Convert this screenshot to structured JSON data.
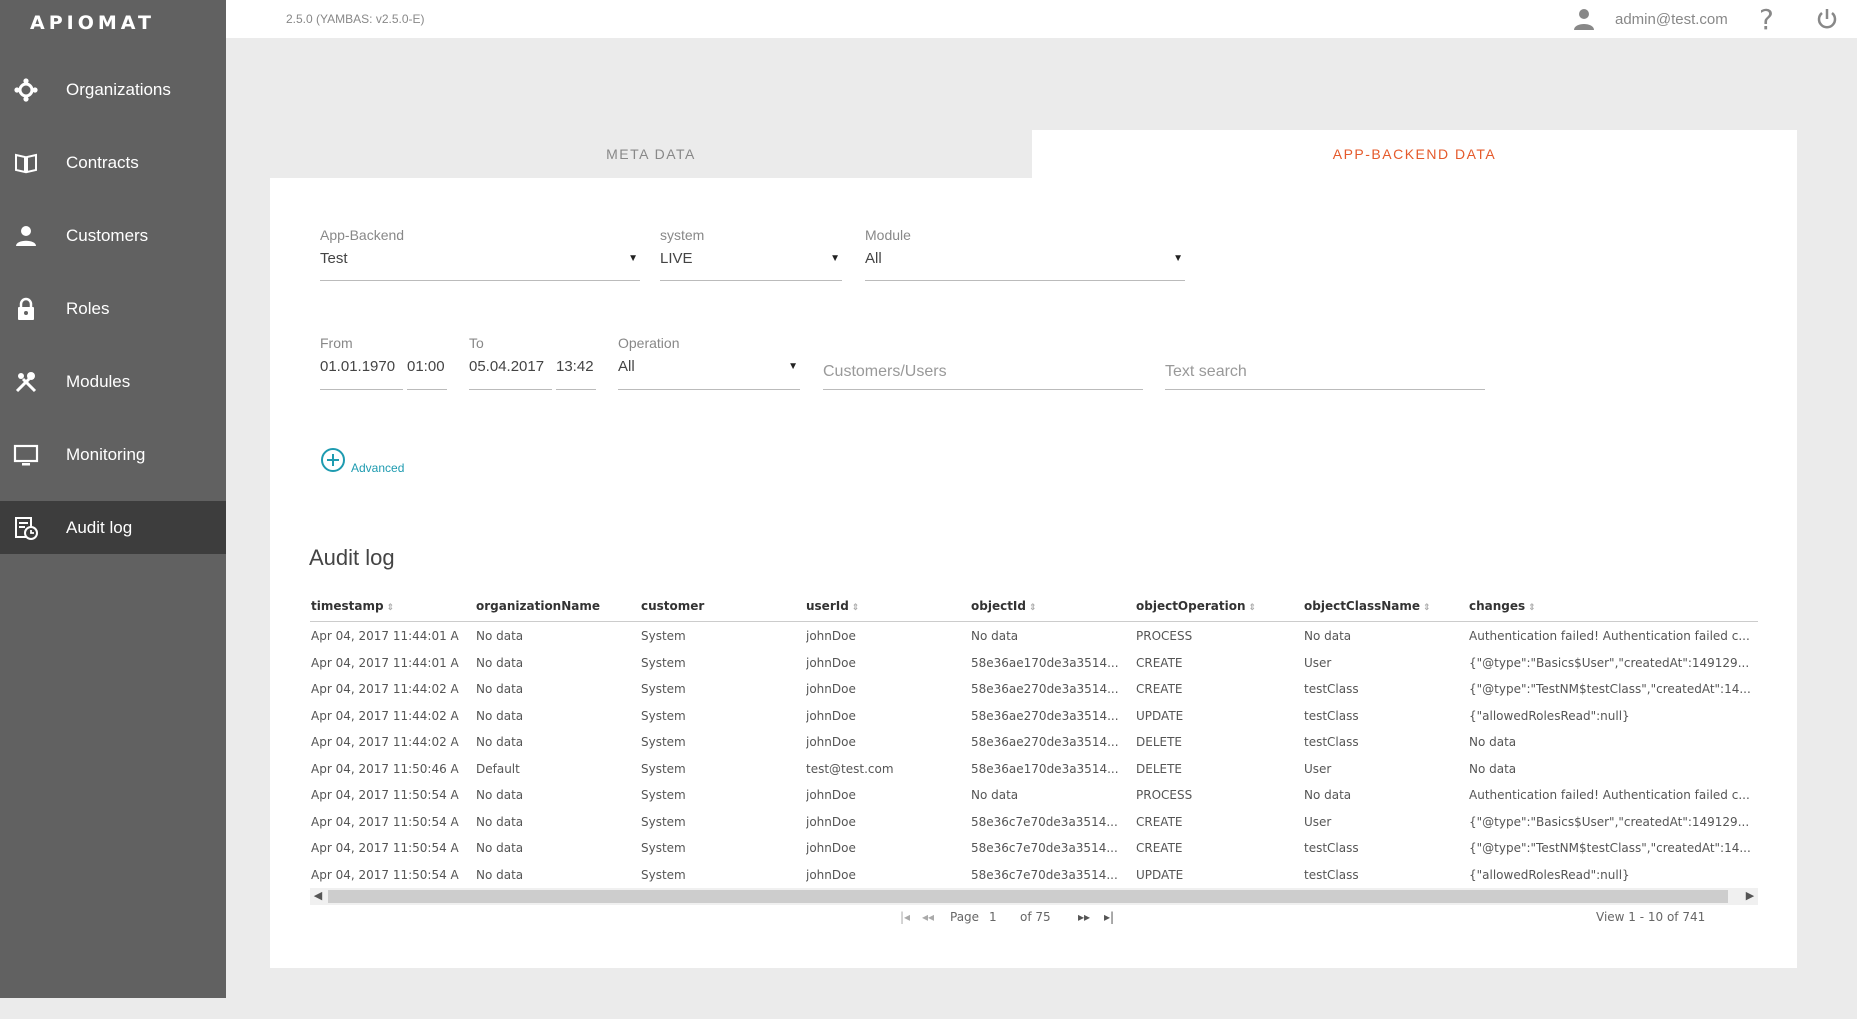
{
  "app": {
    "logo": "APIOMAT",
    "version": "2.5.0 (YAMBAS: v2.5.0-E)"
  },
  "header": {
    "user_email": "admin@test.com",
    "help_symbol": "?"
  },
  "sidebar": {
    "items": [
      {
        "label": "Organizations",
        "icon": "organizations-icon"
      },
      {
        "label": "Contracts",
        "icon": "book-icon"
      },
      {
        "label": "Customers",
        "icon": "person-icon"
      },
      {
        "label": "Roles",
        "icon": "lock-icon"
      },
      {
        "label": "Modules",
        "icon": "tools-icon"
      },
      {
        "label": "Monitoring",
        "icon": "monitor-icon"
      },
      {
        "label": "Audit log",
        "icon": "auditlog-icon",
        "active": true
      }
    ]
  },
  "tabs": [
    {
      "label": "META DATA",
      "active": false
    },
    {
      "label": "APP-BACKEND DATA",
      "active": true
    }
  ],
  "filters": {
    "app_backend": {
      "label": "App-Backend",
      "value": "Test"
    },
    "system": {
      "label": "system",
      "value": "LIVE"
    },
    "module": {
      "label": "Module",
      "value": "All"
    },
    "from": {
      "label": "From",
      "date": "01.01.1970",
      "time": "01:00"
    },
    "to": {
      "label": "To",
      "date": "05.04.2017",
      "time": "13:42"
    },
    "operation": {
      "label": "Operation",
      "value": "All"
    },
    "customers_users": {
      "placeholder": "Customers/Users"
    },
    "text_search": {
      "placeholder": "Text search"
    },
    "advanced_label": "Advanced"
  },
  "audit": {
    "title": "Audit log",
    "columns": [
      "timestamp",
      "organizationName",
      "customer",
      "userId",
      "objectId",
      "objectOperation",
      "objectClassName",
      "changes"
    ],
    "rows": [
      [
        "Apr 04, 2017 11:44:01 A",
        "No data",
        "System",
        "johnDoe",
        "No data",
        "PROCESS",
        "No data",
        "Authentication failed! Authentication failed c..."
      ],
      [
        "Apr 04, 2017 11:44:01 A",
        "No data",
        "System",
        "johnDoe",
        "58e36ae170de3a3514...",
        "CREATE",
        "User",
        "{\"@type\":\"Basics$User\",\"createdAt\":149129..."
      ],
      [
        "Apr 04, 2017 11:44:02 A",
        "No data",
        "System",
        "johnDoe",
        "58e36ae270de3a3514...",
        "CREATE",
        "testClass",
        "{\"@type\":\"TestNM$testClass\",\"createdAt\":14..."
      ],
      [
        "Apr 04, 2017 11:44:02 A",
        "No data",
        "System",
        "johnDoe",
        "58e36ae270de3a3514...",
        "UPDATE",
        "testClass",
        "{\"allowedRolesRead\":null}"
      ],
      [
        "Apr 04, 2017 11:44:02 A",
        "No data",
        "System",
        "johnDoe",
        "58e36ae270de3a3514...",
        "DELETE",
        "testClass",
        "No data"
      ],
      [
        "Apr 04, 2017 11:50:46 A",
        "Default",
        "System",
        "test@test.com",
        "58e36ae170de3a3514...",
        "DELETE",
        "User",
        "No data"
      ],
      [
        "Apr 04, 2017 11:50:54 A",
        "No data",
        "System",
        "johnDoe",
        "No data",
        "PROCESS",
        "No data",
        "Authentication failed! Authentication failed c..."
      ],
      [
        "Apr 04, 2017 11:50:54 A",
        "No data",
        "System",
        "johnDoe",
        "58e36c7e70de3a3514...",
        "CREATE",
        "User",
        "{\"@type\":\"Basics$User\",\"createdAt\":149129..."
      ],
      [
        "Apr 04, 2017 11:50:54 A",
        "No data",
        "System",
        "johnDoe",
        "58e36c7e70de3a3514...",
        "CREATE",
        "testClass",
        "{\"@type\":\"TestNM$testClass\",\"createdAt\":14..."
      ],
      [
        "Apr 04, 2017 11:50:54 A",
        "No data",
        "System",
        "johnDoe",
        "58e36c7e70de3a3514...",
        "UPDATE",
        "testClass",
        "{\"allowedRolesRead\":null}"
      ]
    ]
  },
  "pager": {
    "page_label": "Page",
    "page": "1",
    "of_label": "of 75",
    "view": "View 1 - 10 of 741"
  },
  "colors": {
    "sidebar": "#616161",
    "sidebar_active": "#3d3d3d",
    "accent": "#e55a2b",
    "link": "#1e9bb0"
  }
}
